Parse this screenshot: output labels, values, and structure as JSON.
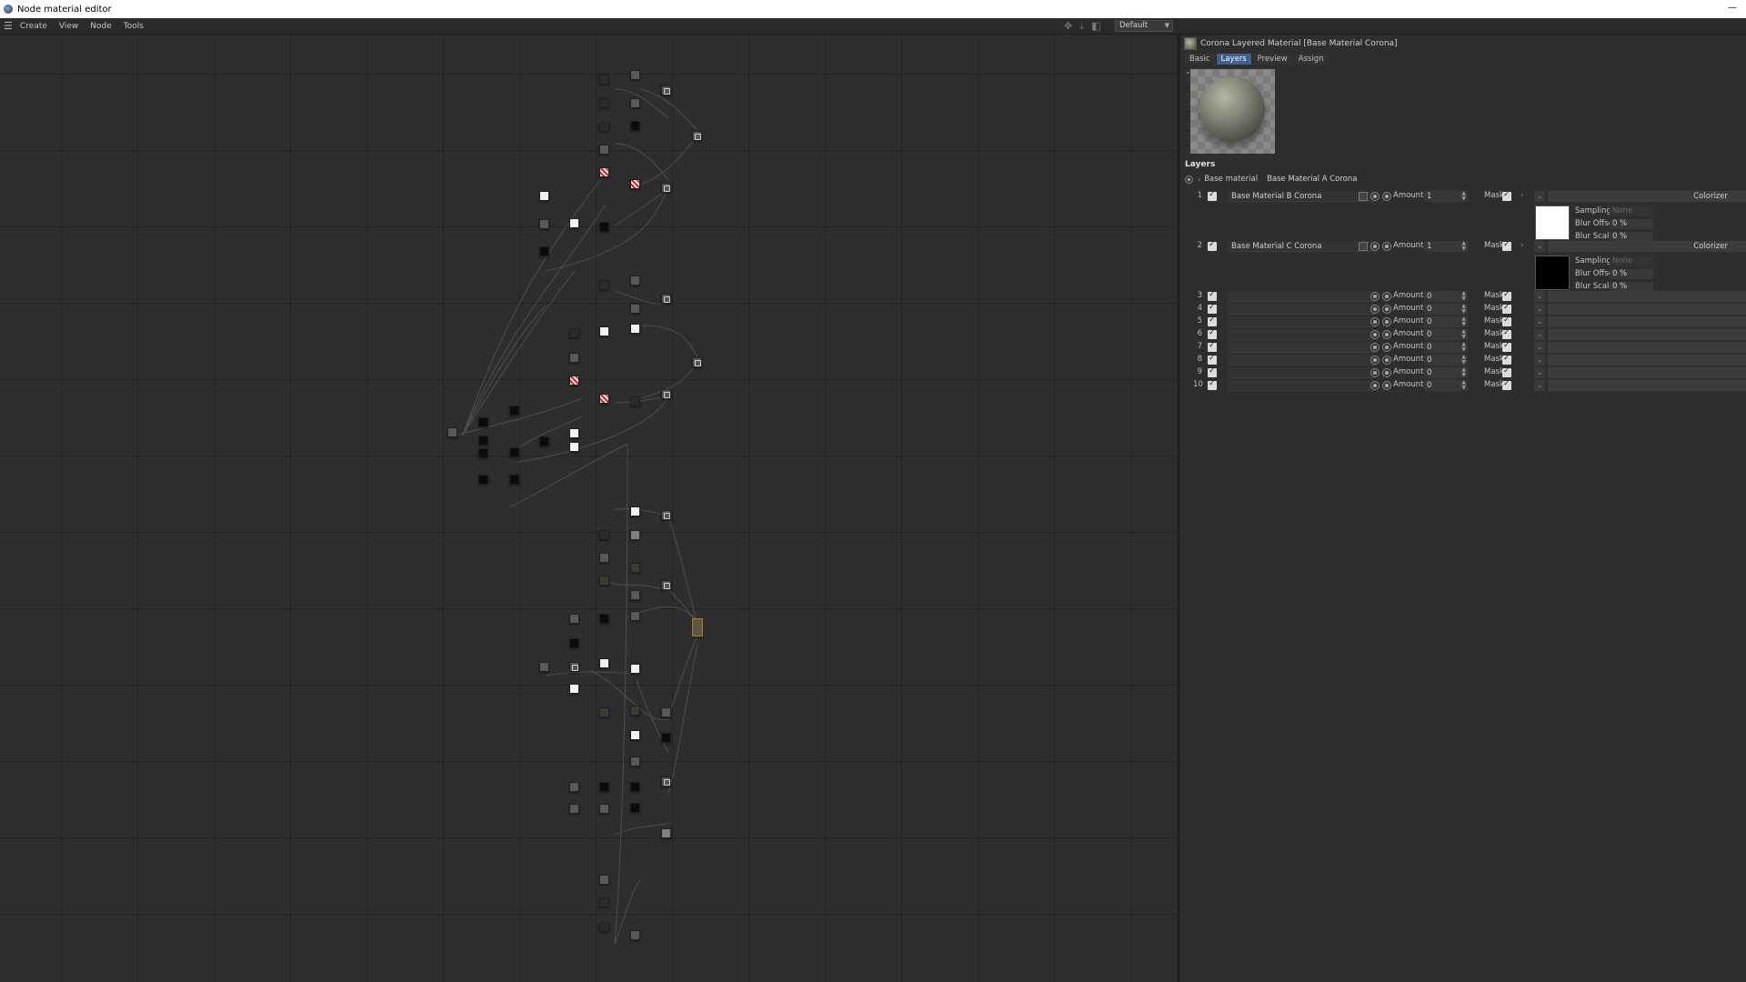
{
  "window": {
    "title": "Node material editor"
  },
  "menu": [
    "Create",
    "View",
    "Node",
    "Tools"
  ],
  "toolbar": {
    "layout_value": "Default"
  },
  "panel": {
    "header": "Corona Layered Material [Base Material Corona]",
    "tabs": [
      "Basic",
      "Layers",
      "Preview",
      "Assign"
    ],
    "active_tab": "Layers",
    "section_title": "Layers",
    "base_label": "Base material",
    "base_value": "Base Material A Corona",
    "amount_label": "Amount",
    "mask_label": "Mask",
    "layers": [
      {
        "index": "1",
        "material": "Base Material B Corona",
        "amount": "1",
        "colorizer": "Colorizer",
        "swatch": "#ffffff",
        "sampling_label": "Sampling",
        "sampling_value": "None",
        "blur_offset_label": "Blur Offset",
        "blur_offset": "0 %",
        "blur_scale_label": "Blur Scale",
        "blur_scale": "0 %"
      },
      {
        "index": "2",
        "material": "Base Material C Corona",
        "amount": "1",
        "colorizer": "Colorizer",
        "swatch": "#000000",
        "sampling_label": "Sampling",
        "sampling_value": "None",
        "blur_offset_label": "Blur Offset",
        "blur_offset": "0 %",
        "blur_scale_label": "Blur Scale",
        "blur_scale": "0 %"
      },
      {
        "index": "3",
        "material": "",
        "amount": "0"
      },
      {
        "index": "4",
        "material": "",
        "amount": "0"
      },
      {
        "index": "5",
        "material": "",
        "amount": "0"
      },
      {
        "index": "6",
        "material": "",
        "amount": "0"
      },
      {
        "index": "7",
        "material": "",
        "amount": "0"
      },
      {
        "index": "8",
        "material": "",
        "amount": "0"
      },
      {
        "index": "9",
        "material": "",
        "amount": "0"
      },
      {
        "index": "10",
        "material": "",
        "amount": "0"
      }
    ]
  }
}
